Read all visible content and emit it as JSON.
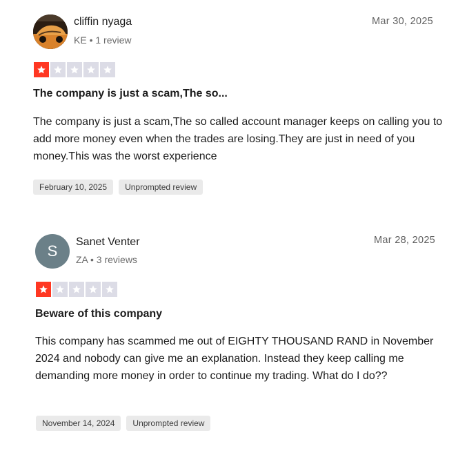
{
  "reviews": [
    {
      "reviewer": {
        "name": "cliffin nyaga",
        "meta": "KE • 1 review",
        "avatar_type": "photo"
      },
      "date": "Mar 30, 2025",
      "rating": 1,
      "rating_max": 5,
      "title": "The company is just a scam,The so...",
      "body": "The company is just a scam,The so called account manager keeps on calling you to add more money even when the trades are losing.They are just in need of you money.This was the worst experience",
      "tags": [
        "February 10, 2025",
        "Unprompted review"
      ]
    },
    {
      "reviewer": {
        "name": "Sanet Venter",
        "meta": "ZA • 3 reviews",
        "avatar_type": "initial",
        "avatar_initial": "S"
      },
      "date": "Mar 28, 2025",
      "rating": 1,
      "rating_max": 5,
      "title": "Beware of this company",
      "body": "This company has scammed me out of EIGHTY THOUSAND RAND in November 2024 and nobody can give me an explanation. Instead they keep calling me demanding more money in order to continue my trading. What do I do??",
      "tags": [
        "November 14, 2024",
        "Unprompted review"
      ]
    }
  ],
  "colors": {
    "star_filled": "#ff3722",
    "star_empty": "#dcdce6",
    "tag_bg": "#eaeaea",
    "avatar_initial_bg": "#6b8088"
  }
}
